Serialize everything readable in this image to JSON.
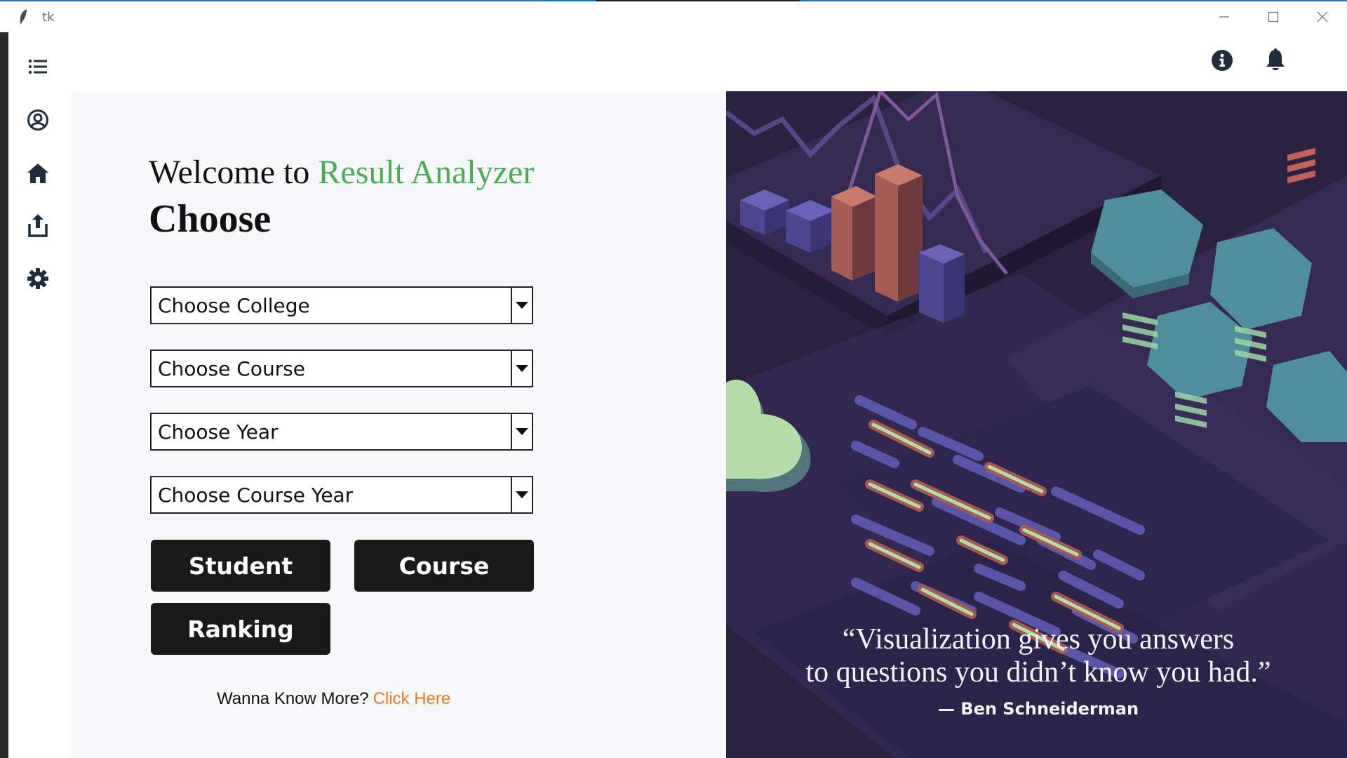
{
  "window": {
    "title": "tk",
    "controls": [
      "minimize-icon",
      "maximize-icon",
      "close-icon"
    ]
  },
  "sidebar": {
    "icons": [
      "menu-list-icon",
      "user-circle-icon",
      "home-icon",
      "upload-icon",
      "gear-icon"
    ]
  },
  "topbar": {
    "icons": [
      "info-icon",
      "bell-icon"
    ]
  },
  "main": {
    "welcome_prefix": "Welcome to",
    "brand": "Result Analyzer",
    "heading": "Choose",
    "dropdowns": [
      {
        "label": "Choose College"
      },
      {
        "label": "Choose Course"
      },
      {
        "label": "Choose Year"
      },
      {
        "label": "Choose Course Year"
      }
    ],
    "buttons": {
      "student": "Student",
      "course": "Course",
      "ranking": "Ranking"
    },
    "more_text": "Wanna Know More?",
    "more_link": "Click Here"
  },
  "hero": {
    "quote_line1": "“Visualization gives you answers",
    "quote_line2": "to questions you didn’t know you had.”",
    "author": "— Ben Schneiderman"
  },
  "colors": {
    "brand_green": "#4aad52",
    "link_orange": "#f07a22",
    "button_bg": "#1a1a1a",
    "hero_bg": "#2a2240",
    "panel_bg": "#f5f7fa",
    "icon_color": "#1f2d3d"
  }
}
